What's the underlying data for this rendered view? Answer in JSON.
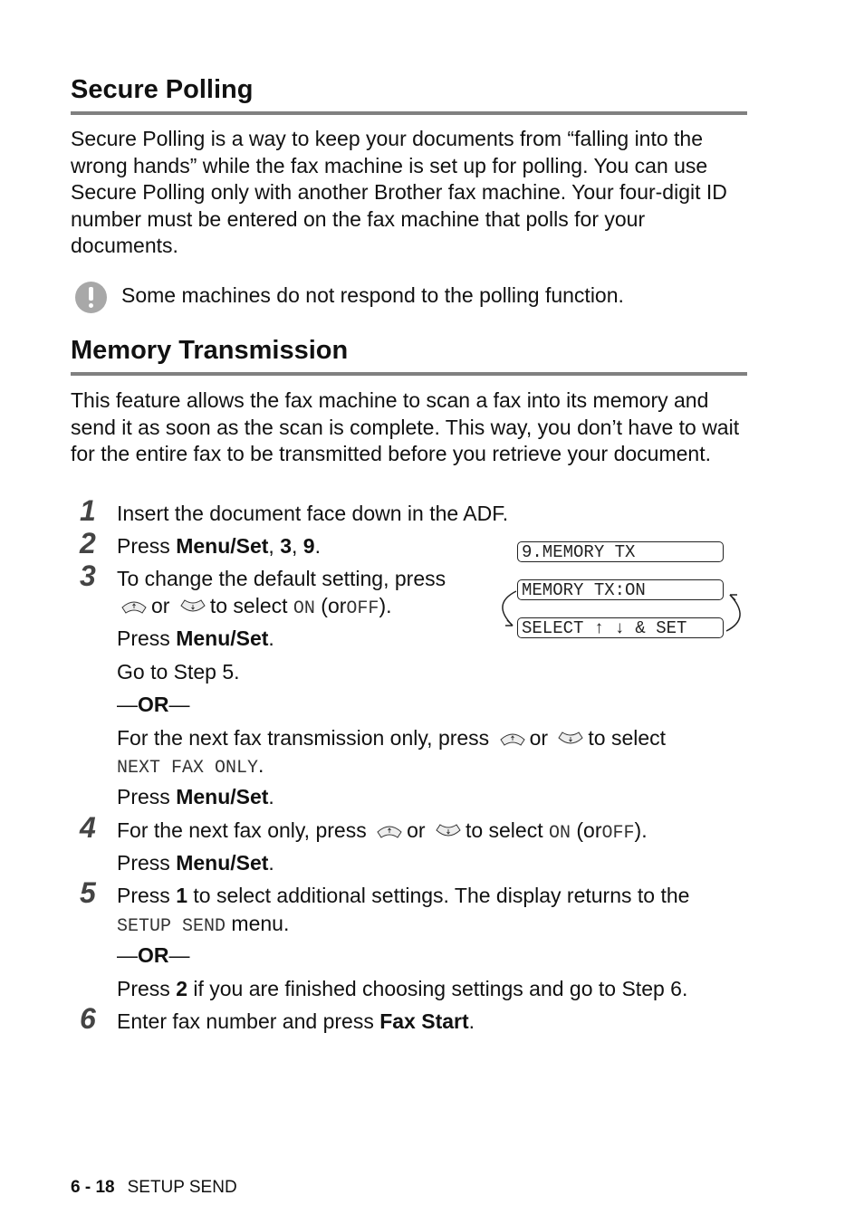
{
  "section1": {
    "title": "Secure Polling",
    "body": "Secure Polling is a way to keep your documents from “falling into the wrong hands” while the fax machine is set up for polling. You can use Secure Polling only with another Brother fax machine. Your four-digit ID number must be entered on the fax machine that polls for your documents.",
    "note_icon": "exclamation-icon",
    "note": "Some machines do not respond to the polling function."
  },
  "section2": {
    "title": "Memory Transmission",
    "body": "This feature allows the fax machine to scan a fax into its memory and send it as soon as the scan is complete. This way, you don’t have to wait for the entire fax to be transmitted before you retrieve your document."
  },
  "steps": {
    "s1": {
      "num": "1",
      "text": "Insert the document face down in the ADF."
    },
    "s2": {
      "num": "2",
      "press": "Press ",
      "key": "Menu/Set",
      "sep1": ", ",
      "k2": "3",
      "sep2": ", ",
      "k3": "9",
      "end": "."
    },
    "s3": {
      "num": "3",
      "l1": "To change the default setting, press",
      "or": "or",
      "to_select": "to select",
      "on": "ON",
      "or_open": "(or",
      "off": "OFF",
      "close": ").",
      "press": "Press ",
      "key": "Menu/Set",
      "dot": ".",
      "goto": "Go to Step 5.",
      "or_sep_dash1": "—",
      "or_sep": "OR",
      "or_sep_dash2": "—",
      "alt1": "For the next fax transmission only, press",
      "alt_or": "or",
      "alt_to_select": "to select",
      "alt_value": "NEXT FAX ONLY",
      "alt_dot": ".",
      "alt_press": "Press ",
      "alt_key": "Menu/Set",
      "alt_end": "."
    },
    "s4": {
      "num": "4",
      "l1": "For the next fax only, press",
      "or": "or",
      "to_select": "to select",
      "on": "ON",
      "or_open": "(or",
      "off": "OFF",
      "close": ").",
      "press": "Press ",
      "key": "Menu/Set",
      "dot": "."
    },
    "s5": {
      "num": "5",
      "press": "Press ",
      "key": "1",
      "rest": " to select additional settings. The display returns to the",
      "menu_value": "SETUP SEND",
      "menu_word": " menu.",
      "or_dash1": "—",
      "or_sep": "OR",
      "or_dash2": "—",
      "press2": "Press ",
      "key2": "2",
      "rest2": " if you are finished choosing settings and go to Step 6."
    },
    "s6": {
      "num": "6",
      "text": "Enter fax number and press ",
      "key": "Fax Start",
      "end": "."
    }
  },
  "lcd": {
    "line1": "9.MEMORY TX",
    "line2": "MEMORY TX:ON",
    "line3": "SELECT ↑ ↓ & SET"
  },
  "icons": {
    "up": "up-arrow-button-icon",
    "down": "down-arrow-button-icon"
  },
  "footer": {
    "page": "6 - 18",
    "chapter": "SETUP SEND"
  }
}
